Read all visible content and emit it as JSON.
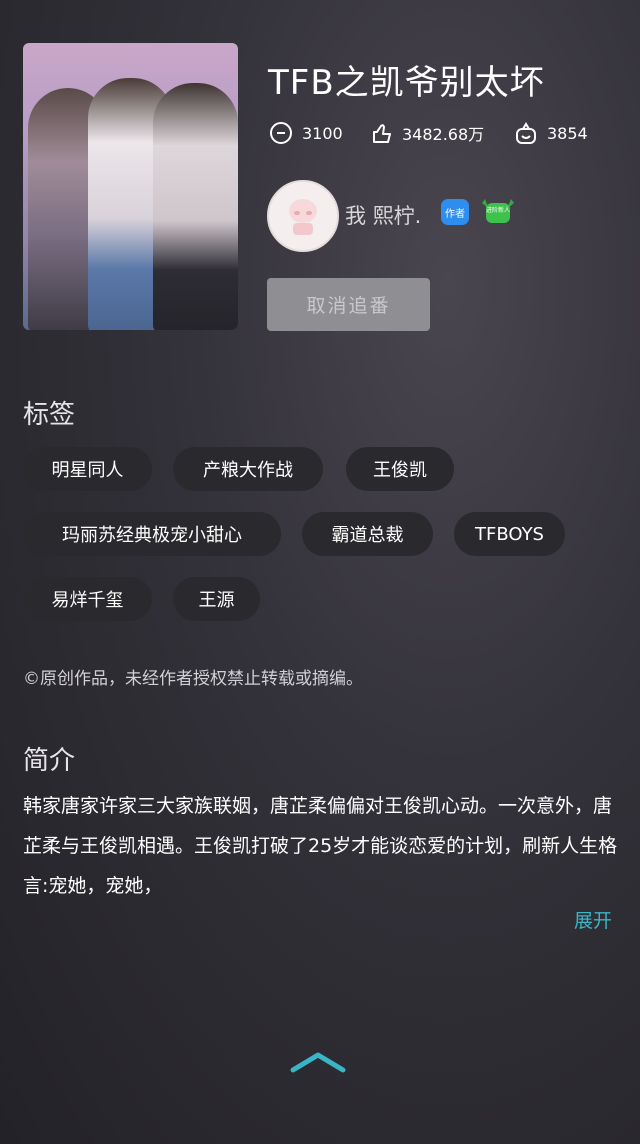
{
  "book": {
    "title": "TFB之凯爷别太坏",
    "stats": {
      "comments": "3100",
      "likes": "3482.68万",
      "followers": "3854"
    }
  },
  "author": {
    "name": "我 熙柠.",
    "author_badge": "作者",
    "level_badge": "进阶新人"
  },
  "follow_button": "取消追番",
  "tags_section": {
    "heading": "标签",
    "tags": [
      "明星同人",
      "产粮大作战",
      "王俊凯",
      "玛丽苏经典极宠小甜心",
      "霸道总裁",
      "TFBOYS",
      "易烊千玺",
      "王源"
    ]
  },
  "copyright_notice": "©原创作品，未经作者授权禁止转载或摘编。",
  "intro_section": {
    "heading": "简介",
    "text": "韩家唐家许家三大家族联姻，唐芷柔偏偏对王俊凯心动。一次意外，唐芷柔与王俊凯相遇。王俊凯打破了25岁才能谈恋爱的计划，刷新人生格言:宠她，宠她，",
    "expand_label": "展开"
  },
  "colors": {
    "accent": "#3ab5c6",
    "tag_bg": "#2a292e",
    "button_bg": "#8f8e92"
  }
}
